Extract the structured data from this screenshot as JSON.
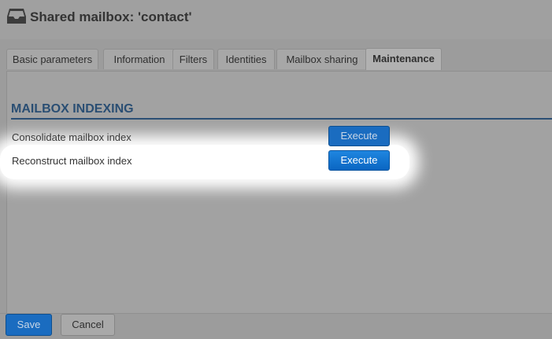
{
  "header": {
    "title": "Shared mailbox: 'contact'",
    "icon": "inbox-tray-icon"
  },
  "tabs": [
    {
      "label": "Basic parameters"
    },
    {
      "label": "Information"
    },
    {
      "label": "Filters"
    },
    {
      "label": "Identities"
    },
    {
      "label": "Mailbox sharing"
    },
    {
      "label": "Maintenance",
      "active": true
    }
  ],
  "section": {
    "title": "MAILBOX INDEXING",
    "rows": [
      {
        "label": "Consolidate mailbox index",
        "button": "Execute"
      },
      {
        "label": "Reconstruct mailbox index",
        "button": "Execute",
        "highlighted": true
      }
    ]
  },
  "footer": {
    "save_label": "Save",
    "cancel_label": "Cancel"
  },
  "colors": {
    "accent": "#1a6cc0",
    "section_title": "#2a4e73",
    "overlay": "#9c9c9c"
  }
}
